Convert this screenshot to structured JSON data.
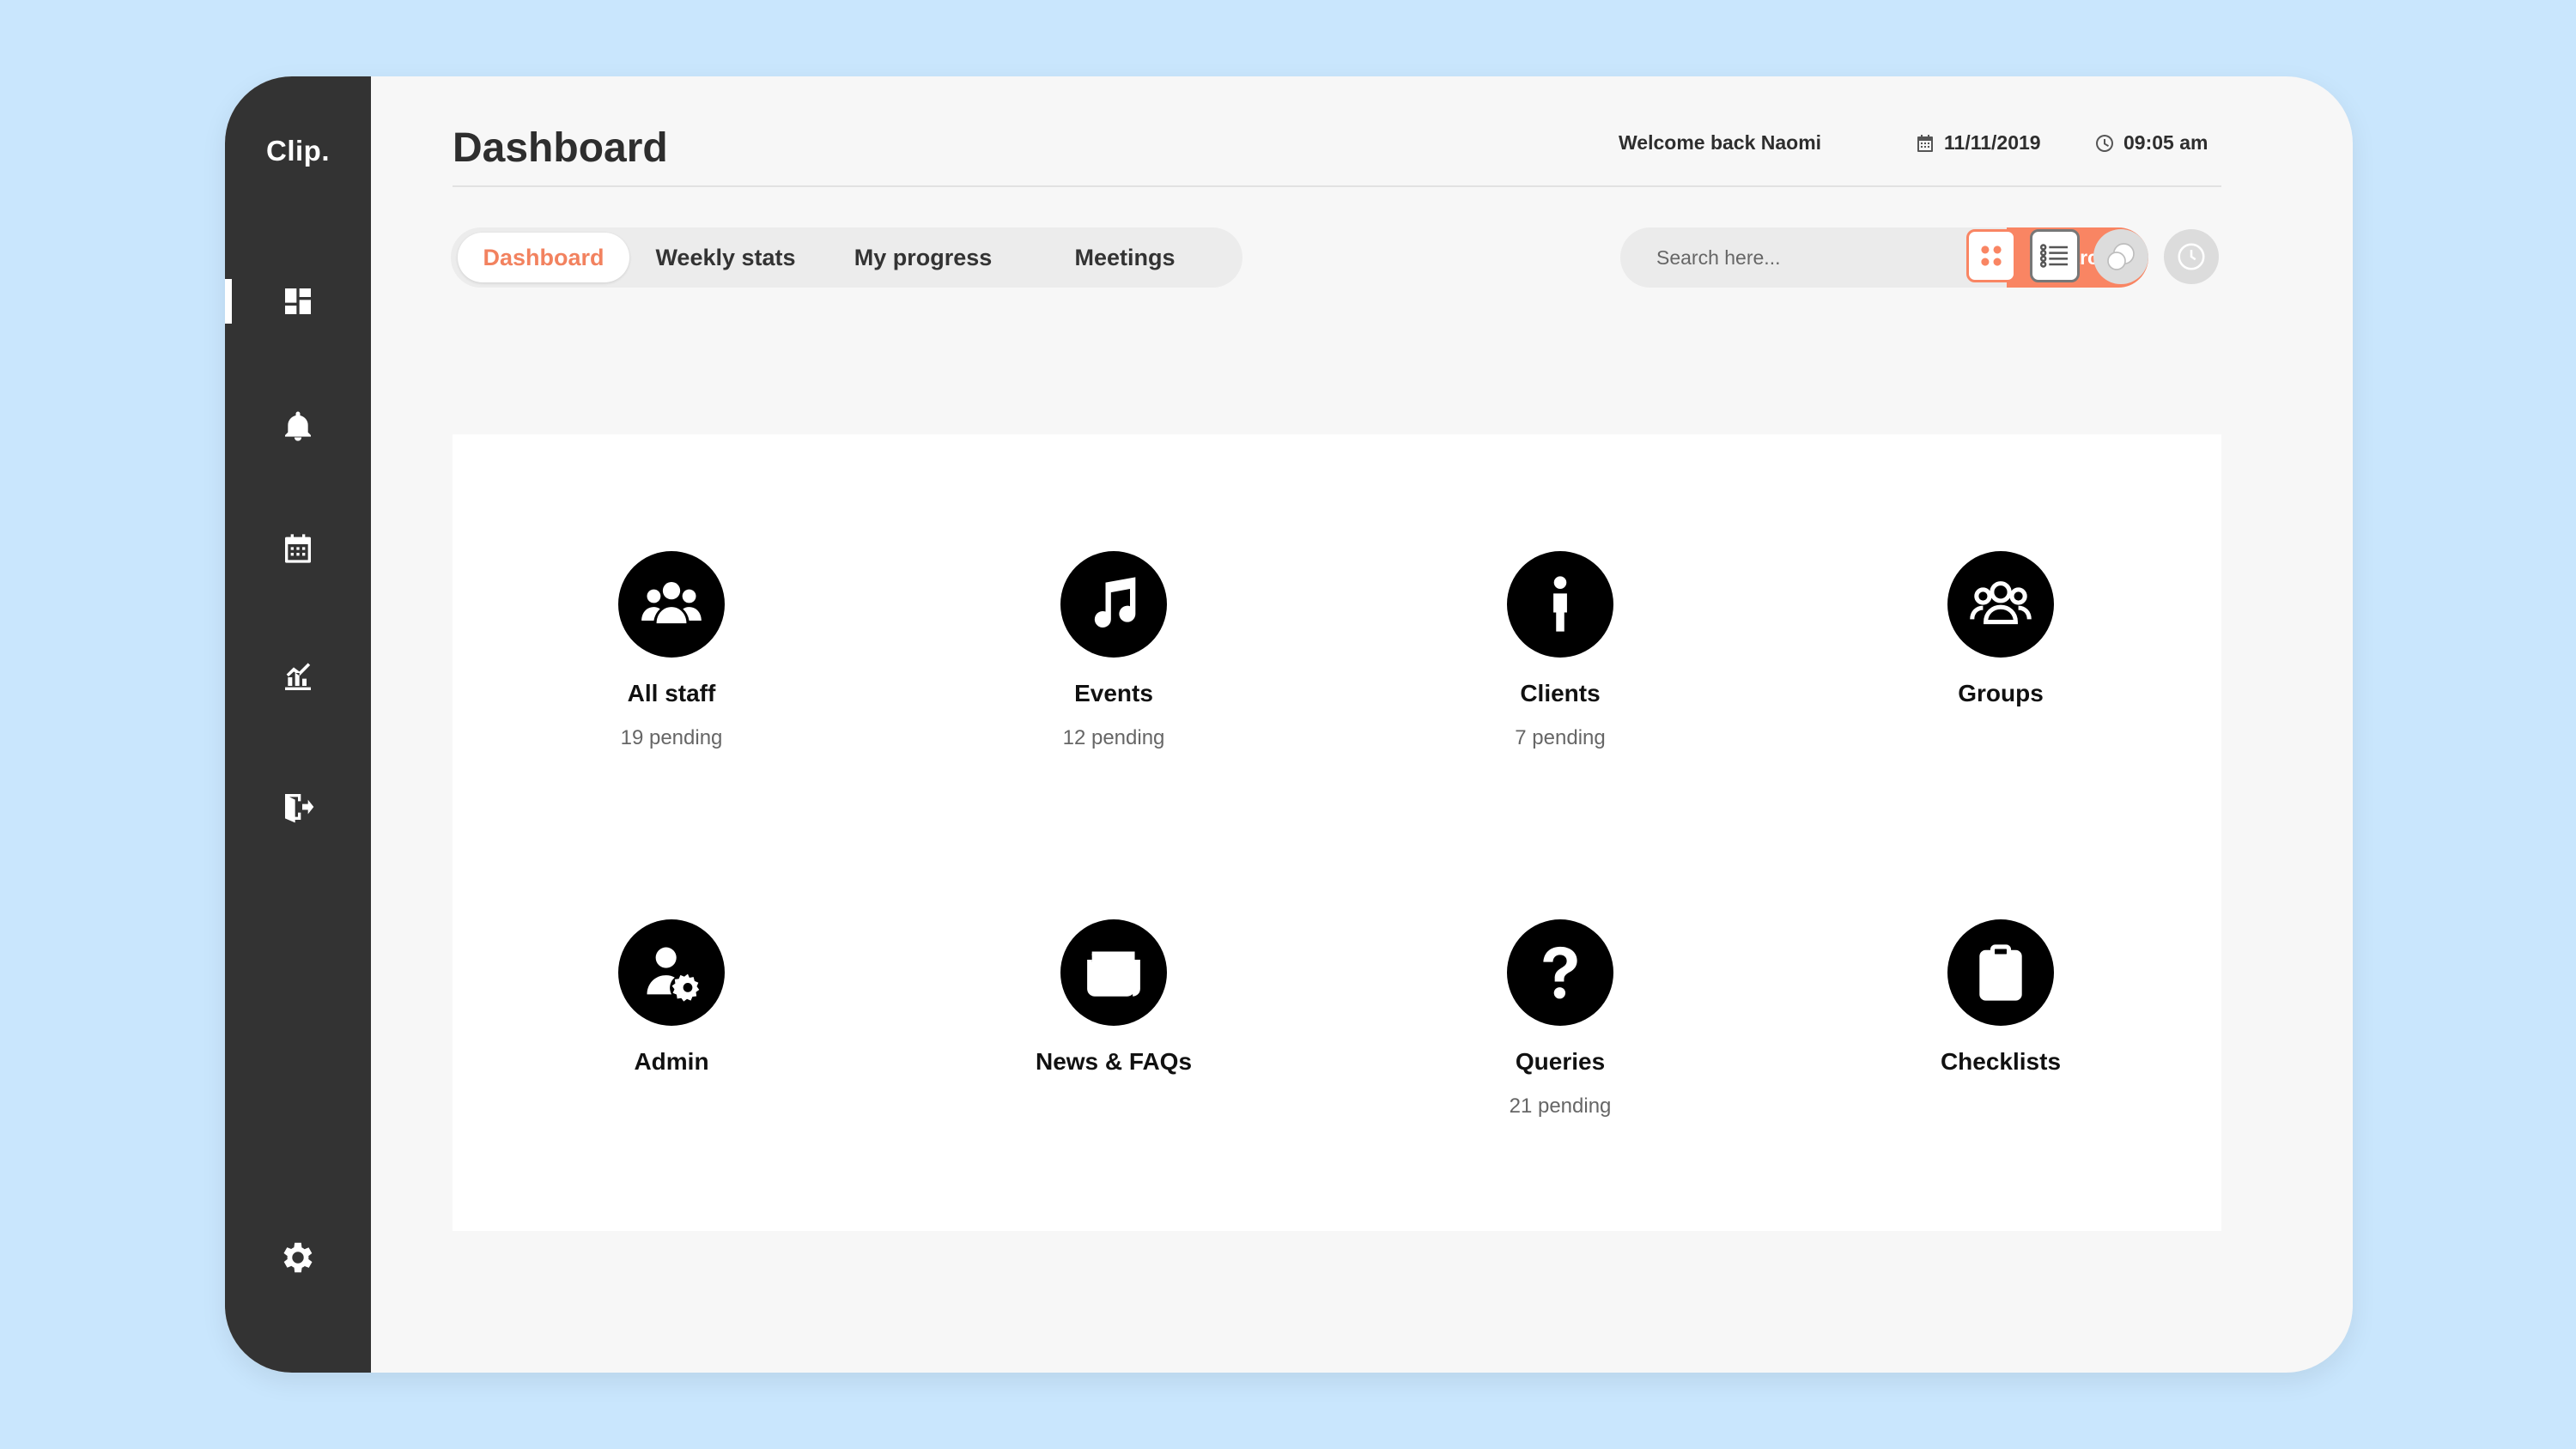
{
  "app": {
    "logo": "Clip."
  },
  "sidebar": {
    "items": [
      {
        "icon": "dashboard-icon",
        "active": true
      },
      {
        "icon": "bell-icon"
      },
      {
        "icon": "calendar-icon"
      },
      {
        "icon": "chart-icon"
      },
      {
        "icon": "logout-icon"
      }
    ],
    "settings_icon": "gear-icon"
  },
  "header": {
    "title": "Dashboard",
    "welcome": "Welcome back Naomi",
    "date": "11/11/2019",
    "time": "09:05 am"
  },
  "tabs": [
    {
      "label": "Dashboard",
      "active": true
    },
    {
      "label": "Weekly stats"
    },
    {
      "label": "My progress"
    },
    {
      "label": "Meetings"
    }
  ],
  "search": {
    "placeholder": "Search here...",
    "button_label": "Search"
  },
  "view_controls": [
    "grid-view-icon",
    "list-view-icon",
    "chat-bubbles-icon",
    "clock-icon"
  ],
  "colors": {
    "accent": "#f98563",
    "sidebar": "#333333",
    "background": "#c9e6fd",
    "panel": "#ffffff"
  },
  "tiles": [
    {
      "label": "All staff",
      "sub": "19 pending",
      "icon": "users-icon"
    },
    {
      "label": "Events",
      "sub": "12 pending",
      "icon": "music-note-icon"
    },
    {
      "label": "Clients",
      "sub": "7 pending",
      "icon": "person-icon"
    },
    {
      "label": "Groups",
      "sub": "",
      "icon": "group-icon"
    },
    {
      "label": "Admin",
      "sub": "",
      "icon": "user-gear-icon"
    },
    {
      "label": "News & FAQs",
      "sub": "",
      "icon": "newspaper-icon"
    },
    {
      "label": "Queries",
      "sub": "21 pending",
      "icon": "question-icon"
    },
    {
      "label": "Checklists",
      "sub": "",
      "icon": "clipboard-check-icon"
    }
  ]
}
